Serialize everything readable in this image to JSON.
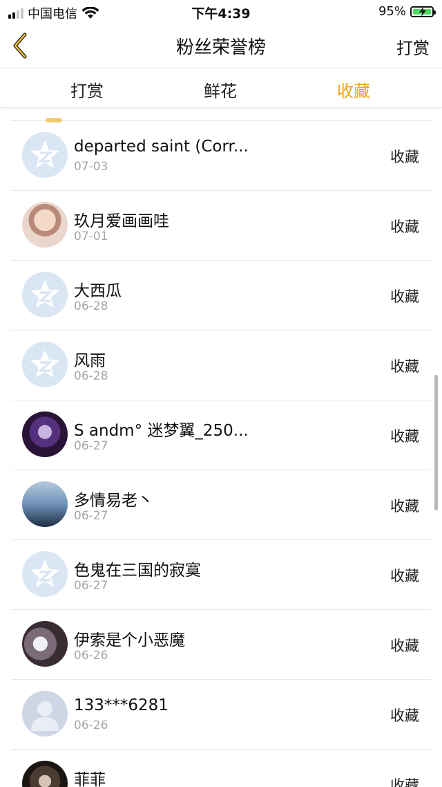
{
  "status_bar": {
    "carrier": "中国电信",
    "time": "下午4:39",
    "battery": "95%"
  },
  "nav": {
    "title": "粉丝荣誉榜",
    "right_button": "打赏",
    "back_icon": "chevron-left-icon"
  },
  "tabs": [
    {
      "label": "打赏",
      "active": false
    },
    {
      "label": "鲜花",
      "active": false
    },
    {
      "label": "收藏",
      "active": true
    }
  ],
  "colors": {
    "accent": "#f0a30a",
    "date_gray": "#a6a6a6",
    "divider": "#e9e9e9"
  },
  "list": [
    {
      "name": "departed saint (Corr...",
      "date": "07-03",
      "action": "收藏",
      "avatar": "default-avatar-icon"
    },
    {
      "name": "玖月爱画画哇",
      "date": "07-01",
      "action": "收藏",
      "avatar": "photo"
    },
    {
      "name": "大西瓜",
      "date": "06-28",
      "action": "收藏",
      "avatar": "default-avatar-icon"
    },
    {
      "name": "风雨",
      "date": "06-28",
      "action": "收藏",
      "avatar": "default-avatar-icon"
    },
    {
      "name": "S andm° 迷梦翼_250...",
      "date": "06-27",
      "action": "收藏",
      "avatar": "photo"
    },
    {
      "name": "多情易老丶",
      "date": "06-27",
      "action": "收藏",
      "avatar": "photo"
    },
    {
      "name": "色鬼在三国的寂寞",
      "date": "06-27",
      "action": "收藏",
      "avatar": "default-avatar-icon"
    },
    {
      "name": "伊索是个小恶魔",
      "date": "06-26",
      "action": "收藏",
      "avatar": "photo"
    },
    {
      "name": "133***6281",
      "date": "06-26",
      "action": "收藏",
      "avatar": "person-silhouette-icon"
    },
    {
      "name": "菲菲",
      "date": "",
      "action": "收藏",
      "avatar": "photo"
    }
  ]
}
